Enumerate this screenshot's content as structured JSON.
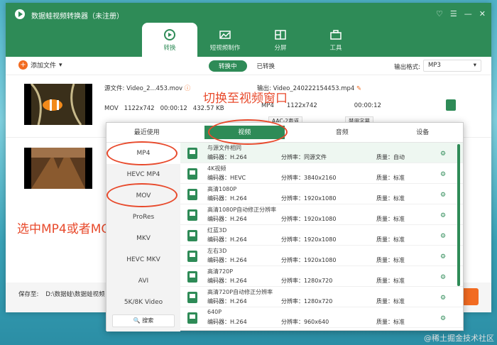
{
  "window": {
    "title": "数据蛙视频转换器（未注册）",
    "controls": [
      "♡",
      "☰",
      "—",
      "✕"
    ]
  },
  "tabs": [
    {
      "label": "转换"
    },
    {
      "label": "短视频制作"
    },
    {
      "label": "分屏"
    },
    {
      "label": "工具"
    }
  ],
  "toolbar": {
    "add_label": "添加文件",
    "converting": "转换中",
    "converted": "已转换",
    "output_format_label": "输出格式:",
    "output_format_value": "MP3"
  },
  "row1": {
    "src_label": "源文件: Video_2...453.mov",
    "src_fmt": "MOV",
    "src_res": "1122x742",
    "src_dur": "00:00:12",
    "src_size": "432.57 KB",
    "dst_label": "输出: Video_240222154453.mp4",
    "dst_fmt": "MP4",
    "dst_res": "1122x742",
    "dst_dur": "00:00:12",
    "audio": "AAC-2声道",
    "subtitle": "禁用字幕"
  },
  "annotations": {
    "switch": "切换至视频窗口",
    "select": "选中MP4或者MOV"
  },
  "footer": {
    "save_label": "保存至:",
    "save_path": "D:\\数据蛙\\数据蛙视频"
  },
  "popup": {
    "tabs": [
      "最近使用",
      "视频",
      "音频",
      "设备"
    ],
    "formats": [
      "MP4",
      "HEVC MP4",
      "MOV",
      "ProRes",
      "MKV",
      "HEVC MKV",
      "AVI",
      "5K/8K Video"
    ],
    "search_label": "🔍 搜索",
    "presets": [
      {
        "name": "与源文件相同",
        "enc": "编码器：H.264",
        "res": "分辨率：同源文件",
        "q": "质量：自动"
      },
      {
        "name": "4K视频",
        "enc": "编码器：HEVC",
        "res": "分辨率：3840x2160",
        "q": "质量：标准"
      },
      {
        "name": "高清1080P",
        "enc": "编码器：H.264",
        "res": "分辨率：1920x1080",
        "q": "质量：标准"
      },
      {
        "name": "高清1080P自动修正分辨率",
        "enc": "编码器：H.264",
        "res": "分辨率：1920x1080",
        "q": "质量：标准"
      },
      {
        "name": "红蓝3D",
        "enc": "编码器：H.264",
        "res": "分辨率：1920x1080",
        "q": "质量：标准"
      },
      {
        "name": "左右3D",
        "enc": "编码器：H.264",
        "res": "分辨率：1920x1080",
        "q": "质量：标准"
      },
      {
        "name": "高清720P",
        "enc": "编码器：H.264",
        "res": "分辨率：1280x720",
        "q": "质量：标准"
      },
      {
        "name": "高清720P自动修正分辨率",
        "enc": "编码器：H.264",
        "res": "分辨率：1280x720",
        "q": "质量：标准"
      },
      {
        "name": "640P",
        "enc": "编码器：H.264",
        "res": "分辨率：960x640",
        "q": "质量：标准"
      }
    ]
  },
  "watermark": "@稀土掘金技术社区"
}
